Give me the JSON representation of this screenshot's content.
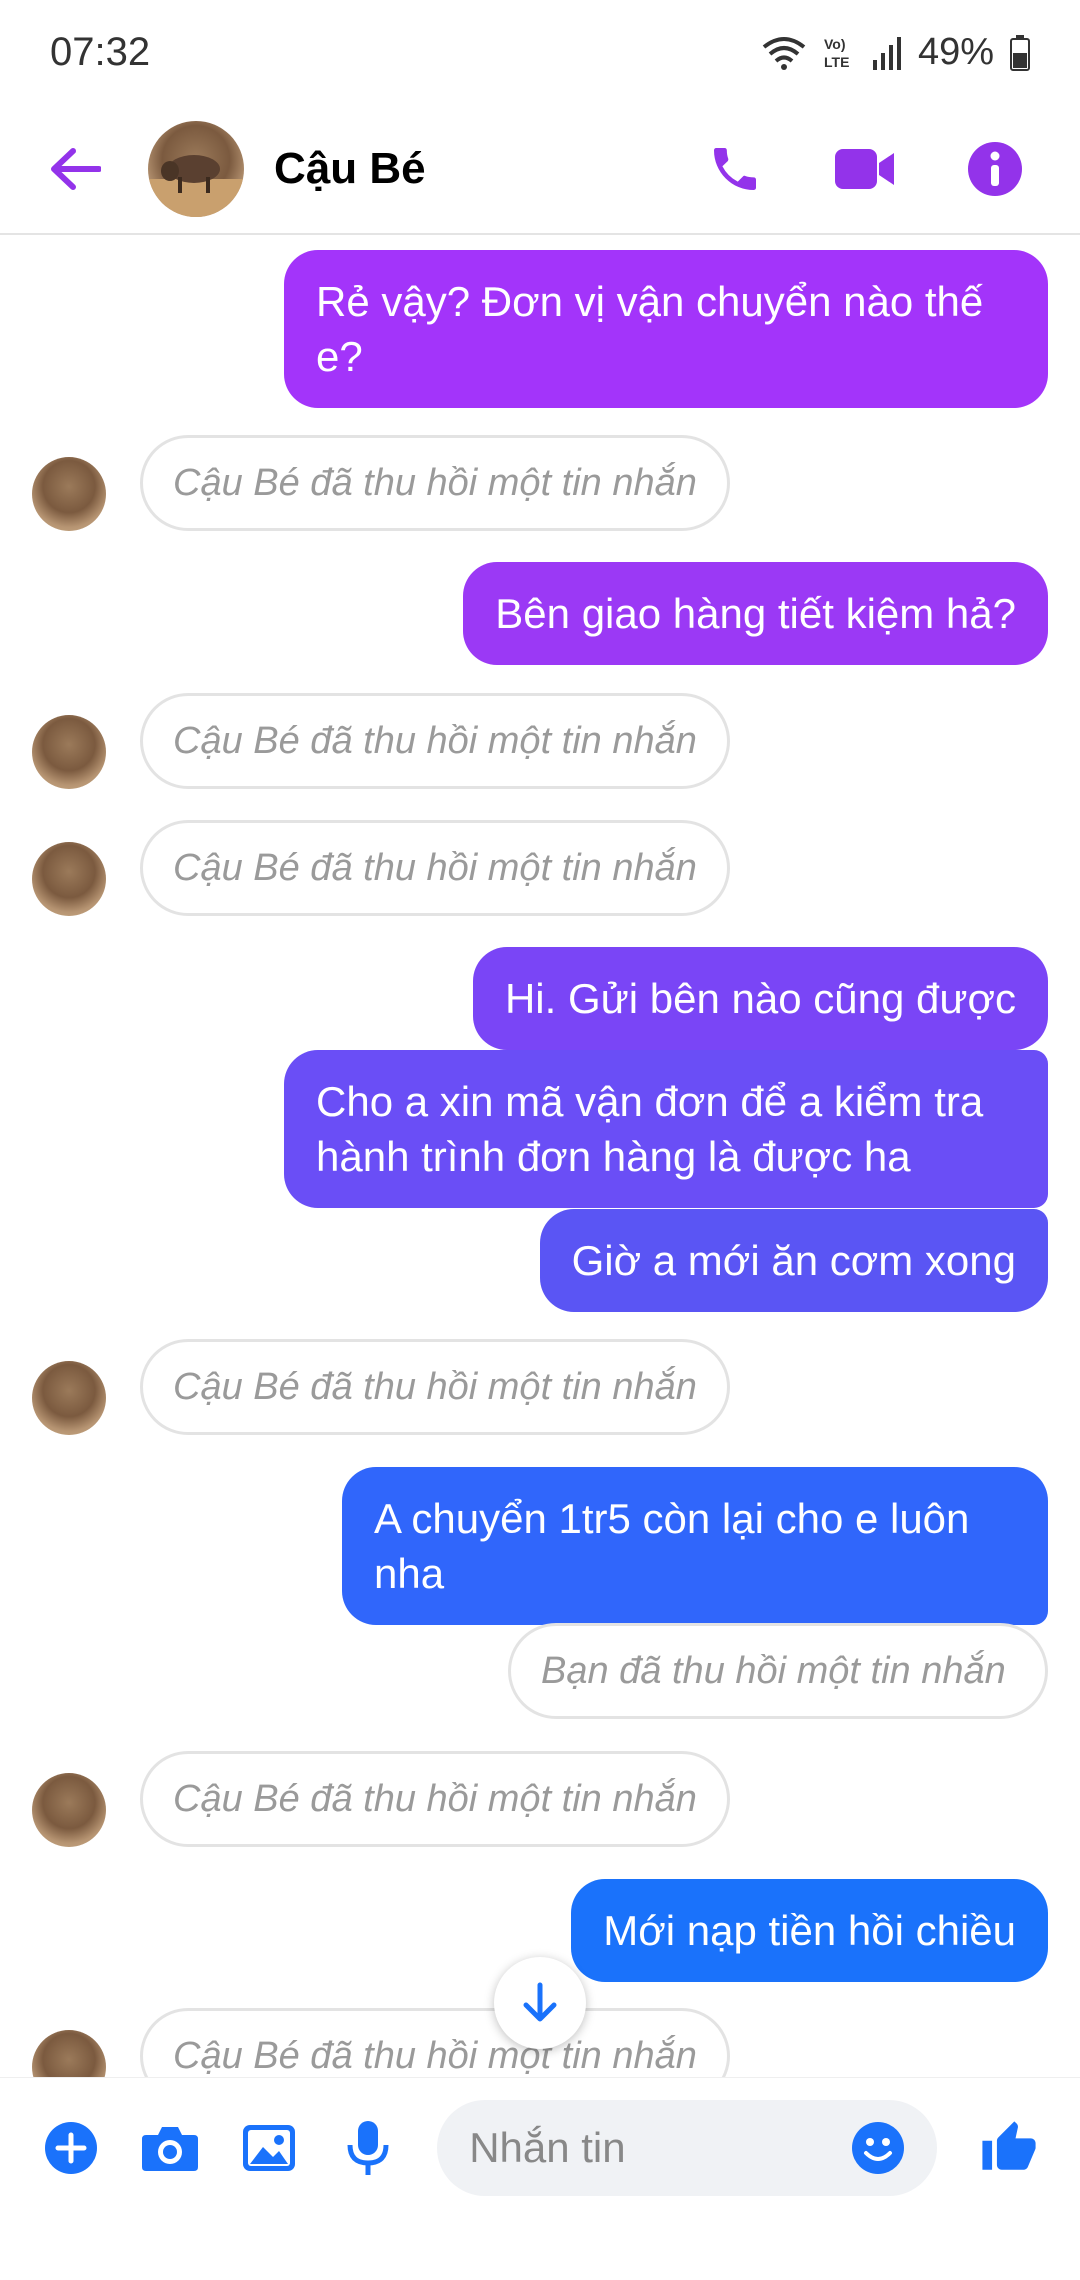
{
  "status_bar": {
    "time": "07:32",
    "battery": "49%",
    "network": "LTE"
  },
  "header": {
    "contact_name": "Cậu Bé"
  },
  "messages": [
    {
      "type": "out",
      "text": "Rẻ vậy? Đơn vị vận chuyển nào thế e?"
    },
    {
      "type": "in_recalled",
      "text": "Cậu Bé đã thu hồi một tin nhắn"
    },
    {
      "type": "out",
      "text": "Bên giao hàng tiết kiệm hả?"
    },
    {
      "type": "in_recalled",
      "text": "Cậu Bé đã thu hồi một tin nhắn"
    },
    {
      "type": "in_recalled",
      "text": "Cậu Bé đã thu hồi một tin nhắn"
    },
    {
      "type": "out",
      "text": "Hi. Gửi bên nào cũng được"
    },
    {
      "type": "out",
      "text": "Cho a xin mã vận đơn để a kiểm tra hành trình đơn hàng là được ha"
    },
    {
      "type": "out",
      "text": "Giờ a mới ăn cơm xong"
    },
    {
      "type": "in_recalled",
      "text": "Cậu Bé đã thu hồi một tin nhắn"
    },
    {
      "type": "out",
      "text": "A chuyển 1tr5 còn lại cho e luôn nha"
    },
    {
      "type": "out_recalled",
      "text": "Bạn đã thu hồi một tin nhắn"
    },
    {
      "type": "in_recalled",
      "text": "Cậu Bé đã thu hồi một tin nhắn"
    },
    {
      "type": "out",
      "text": "Mới nạp tiền hồi chiều"
    },
    {
      "type": "in_recalled",
      "text": "Cậu Bé đã thu hồi một tin nhắn"
    }
  ],
  "composer": {
    "placeholder": "Nhắn tin"
  },
  "colors": {
    "accent": "#9333ea",
    "gradient_top": "#a334fa",
    "gradient_bottom": "#0a7cff"
  }
}
